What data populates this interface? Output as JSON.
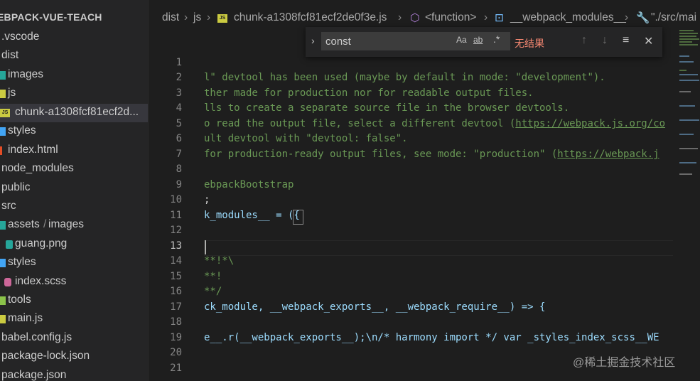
{
  "sidebar": {
    "title": "EBPACK-VUE-TEACH",
    "items": [
      {
        "label": ".vscode",
        "icon": "folder-icon"
      },
      {
        "label": "dist",
        "icon": "folder-icon"
      },
      {
        "label": "images",
        "icon": "folder-images-icon"
      },
      {
        "label": "js",
        "icon": "folder-js-icon"
      },
      {
        "label": "chunk-a1308fcf81ecf2d...",
        "icon": "js-file-icon",
        "active": true
      },
      {
        "label": "styles",
        "icon": "folder-styles-icon"
      },
      {
        "label": "index.html",
        "icon": "html-file-icon"
      },
      {
        "label": "node_modules",
        "icon": "folder-icon"
      },
      {
        "label": "public",
        "icon": "folder-icon"
      },
      {
        "label": "src",
        "icon": "folder-icon"
      },
      {
        "label": "assets",
        "label2": "images",
        "icon": "folder-assets-icon"
      },
      {
        "label": "guang.png",
        "icon": "image-file-icon"
      },
      {
        "label": "styles",
        "icon": "folder-styles-icon"
      },
      {
        "label": "index.scss",
        "icon": "scss-file-icon"
      },
      {
        "label": "tools",
        "icon": "folder-tools-icon"
      },
      {
        "label": "main.js",
        "icon": "js-file-icon"
      },
      {
        "label": "babel.config.js",
        "icon": "babel-file-icon"
      },
      {
        "label": "package-lock.json",
        "icon": "json-file-icon"
      },
      {
        "label": "package.json",
        "icon": "json-file-icon"
      }
    ]
  },
  "breadcrumb": {
    "dist": "dist",
    "js": "js",
    "file": "chunk-a1308fcf81ecf2de0f3e.js",
    "fn": "<function>",
    "modules": "__webpack_modules__",
    "src": "\"./src/mai"
  },
  "find": {
    "value": "const",
    "match_case": "Aa",
    "whole_word": "ab",
    "regex": ".*",
    "result": "无结果"
  },
  "editor": {
    "lines": [
      {
        "n": "1",
        "text": ""
      },
      {
        "n": "2",
        "text": "l\" devtool has been used (maybe by default in mode: \"development\")."
      },
      {
        "n": "3",
        "text": "ther made for production nor for readable output files."
      },
      {
        "n": "4",
        "text": "lls to create a separate source file in the browser devtools."
      },
      {
        "n": "5",
        "text": "o read the output file, select a different devtool (",
        "link": "https://webpack.js.org/co"
      },
      {
        "n": "6",
        "text": "ult devtool with \"devtool: false\"."
      },
      {
        "n": "7",
        "text": "for production-ready output files, see mode: \"production\" (",
        "link": "https://webpack.j"
      },
      {
        "n": "8",
        "text": ""
      },
      {
        "n": "9",
        "text": "ebpackBootstrap"
      },
      {
        "n": "10",
        "text": ";"
      },
      {
        "n": "11",
        "text": "k_modules__ = ({"
      },
      {
        "n": "12",
        "text": ""
      },
      {
        "n": "13",
        "text": ""
      },
      {
        "n": "14",
        "text": "**!*\\"
      },
      {
        "n": "15",
        "text": "**!"
      },
      {
        "n": "16",
        "text": "**/"
      },
      {
        "n": "17",
        "text": "ck_module, __webpack_exports__, __webpack_require__) => {"
      },
      {
        "n": "18",
        "text": ""
      },
      {
        "n": "19",
        "text": "e__.r(__webpack_exports__);\\n/* harmony import */ var _styles_index_scss__WE"
      },
      {
        "n": "20",
        "text": ""
      },
      {
        "n": "21",
        "text": ""
      }
    ]
  },
  "watermark": "@稀土掘金技术社区"
}
